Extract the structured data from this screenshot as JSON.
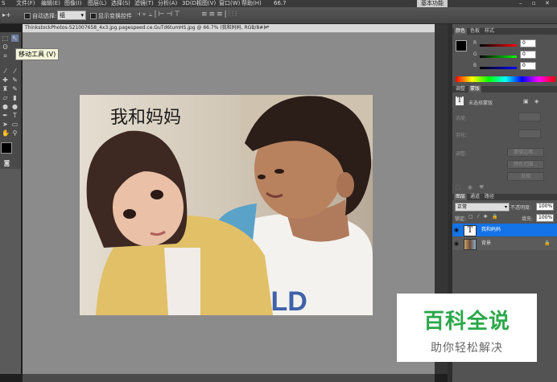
{
  "menu": [
    "文件(F)",
    "编辑(E)",
    "图像(I)",
    "图层(L)",
    "选择(S)",
    "滤镜(T)",
    "分析(A)",
    "3D(D)",
    "视图(V)",
    "窗口(W)",
    "帮助(H)"
  ],
  "zoom_level": "66.7",
  "options_bar": {
    "auto_select_label": "自动选择:",
    "auto_select_value": "组",
    "show_transform_label": "显示变换控件"
  },
  "workspace_button": "基本功能",
  "document_tab": "ThinkstockPhotos-521007658_4x3.jpg.pagespeed.ce.GuTd6tumHS.jpg @ 66.7% (我和妈妈, RGB/8#) *",
  "tooltip": "移动工具 (V)",
  "canvas_caption": "我和妈妈",
  "color_panel": {
    "tabs": [
      "颜色",
      "色板",
      "样式"
    ],
    "channels": [
      {
        "label": "R",
        "value": "0"
      },
      {
        "label": "G",
        "value": "0"
      },
      {
        "label": "B",
        "value": "0"
      }
    ]
  },
  "text_panel": {
    "tabs": [
      "调整",
      "蒙版"
    ],
    "title": "未选择蒙版",
    "density_label": "浓度:",
    "feather_label": "羽化:",
    "refine_label": "调整:",
    "buttons": [
      "蒙版边缘...",
      "颜色范围...",
      "反相"
    ]
  },
  "layers_panel": {
    "tabs": [
      "图层",
      "通道",
      "路径"
    ],
    "blend_mode": "正常",
    "opacity_label": "不透明度:",
    "opacity_value": "100%",
    "lock_label": "锁定:",
    "fill_label": "填充:",
    "fill_value": "100%",
    "layers": [
      {
        "name": "我和妈妈",
        "type": "text",
        "selected": true
      },
      {
        "name": "背景",
        "type": "image",
        "selected": false
      }
    ]
  },
  "watermark": {
    "title": "百科全说",
    "subtitle": "助你轻松解决"
  },
  "colors": {
    "selection": "#1473e6",
    "watermark_green": "#2aa84a"
  }
}
